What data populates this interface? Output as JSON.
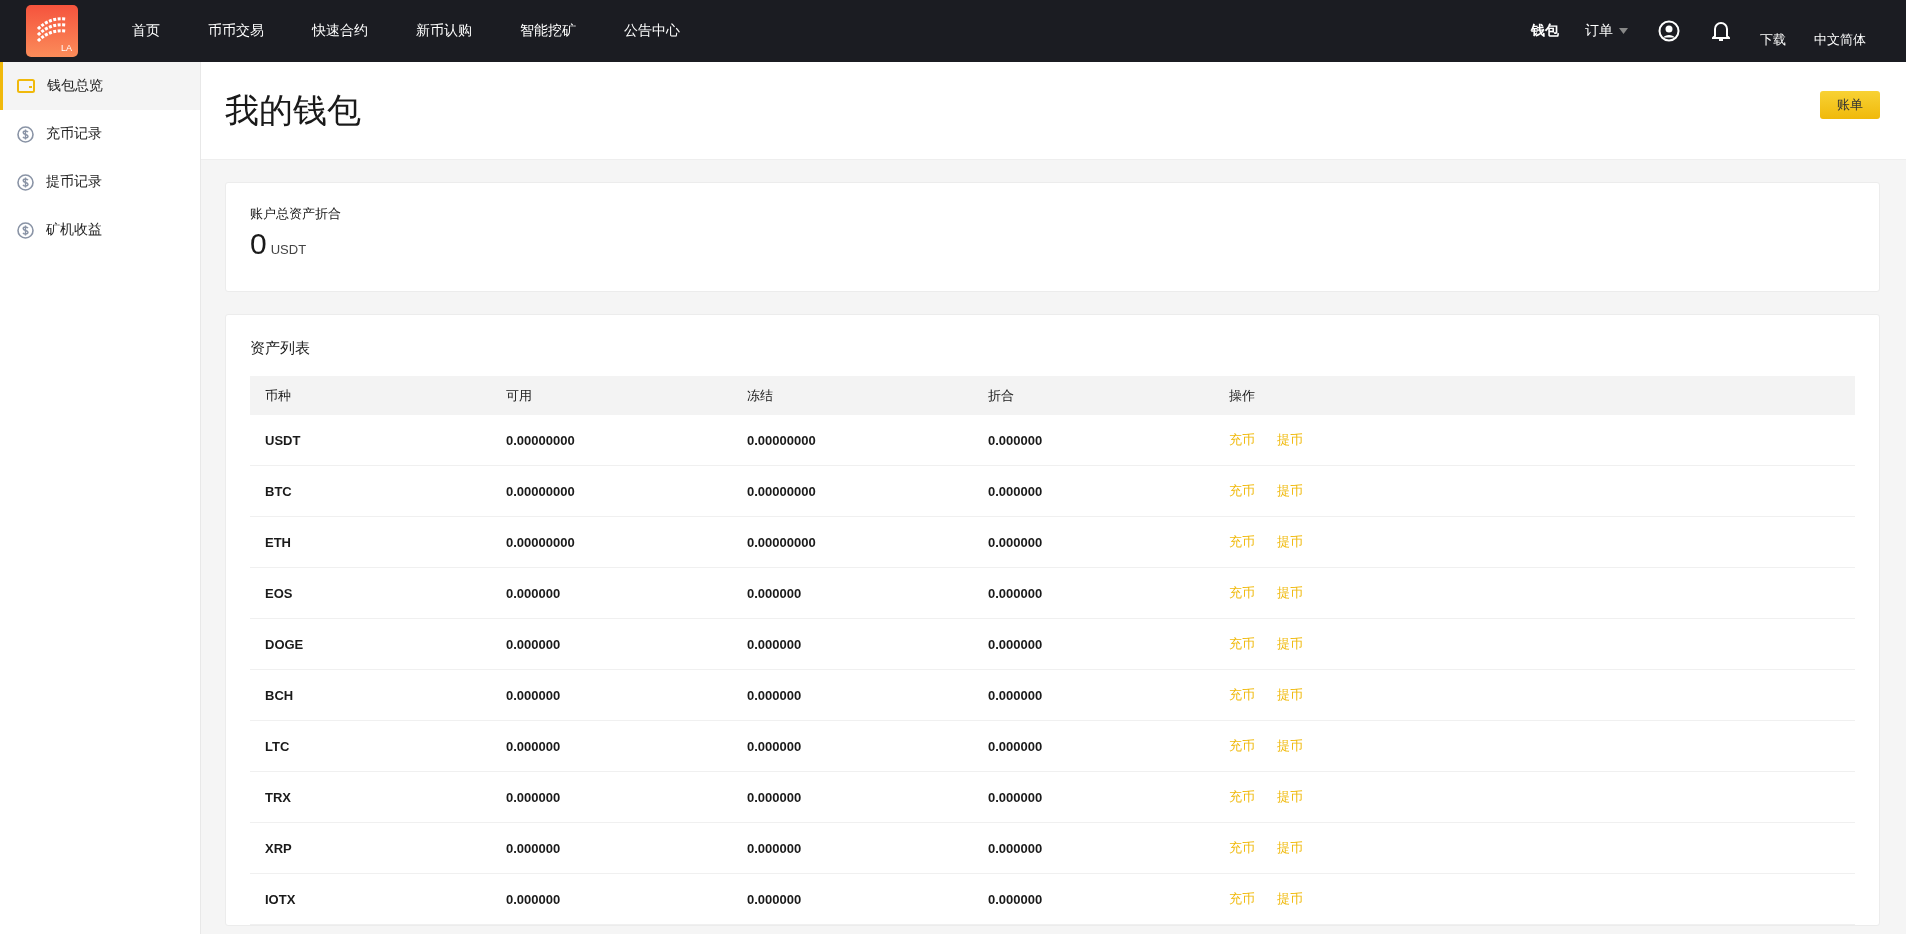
{
  "header": {
    "logo_text": "LA",
    "nav": [
      "首页",
      "币币交易",
      "快速合约",
      "新币认购",
      "智能挖矿",
      "公告中心"
    ],
    "right": {
      "wallet": "钱包",
      "orders": "订单",
      "download": "下载",
      "language": "中文简体"
    }
  },
  "sidebar": {
    "items": [
      {
        "label": "钱包总览",
        "kind": "wallet",
        "selected": true
      },
      {
        "label": "充币记录",
        "kind": "coin",
        "selected": false
      },
      {
        "label": "提币记录",
        "kind": "coin",
        "selected": false
      },
      {
        "label": "矿机收益",
        "kind": "coin",
        "selected": false
      }
    ]
  },
  "page": {
    "title": "我的钱包",
    "bill_button": "账单"
  },
  "summary": {
    "label": "账户总资产折合",
    "amount": "0",
    "unit": "USDT"
  },
  "assets": {
    "title": "资产列表",
    "columns": [
      "币种",
      "可用",
      "冻结",
      "折合",
      "操作"
    ],
    "rows": [
      {
        "coin": "USDT",
        "available": "0.00000000",
        "frozen": "0.00000000",
        "value": "0.000000",
        "actions": [
          "充币",
          "提币"
        ]
      },
      {
        "coin": "BTC",
        "available": "0.00000000",
        "frozen": "0.00000000",
        "value": "0.000000",
        "actions": [
          "充币",
          "提币"
        ]
      },
      {
        "coin": "ETH",
        "available": "0.00000000",
        "frozen": "0.00000000",
        "value": "0.000000",
        "actions": [
          "充币",
          "提币"
        ]
      },
      {
        "coin": "EOS",
        "available": "0.000000",
        "frozen": "0.000000",
        "value": "0.000000",
        "actions": [
          "充币",
          "提币"
        ]
      },
      {
        "coin": "DOGE",
        "available": "0.000000",
        "frozen": "0.000000",
        "value": "0.000000",
        "actions": [
          "充币",
          "提币"
        ]
      },
      {
        "coin": "BCH",
        "available": "0.000000",
        "frozen": "0.000000",
        "value": "0.000000",
        "actions": [
          "充币",
          "提币"
        ]
      },
      {
        "coin": "LTC",
        "available": "0.000000",
        "frozen": "0.000000",
        "value": "0.000000",
        "actions": [
          "充币",
          "提币"
        ]
      },
      {
        "coin": "TRX",
        "available": "0.000000",
        "frozen": "0.000000",
        "value": "0.000000",
        "actions": [
          "充币",
          "提币"
        ]
      },
      {
        "coin": "XRP",
        "available": "0.000000",
        "frozen": "0.000000",
        "value": "0.000000",
        "actions": [
          "充币",
          "提币"
        ]
      },
      {
        "coin": "IOTX",
        "available": "0.000000",
        "frozen": "0.000000",
        "value": "0.000000",
        "actions": [
          "充币",
          "提币"
        ]
      }
    ]
  }
}
